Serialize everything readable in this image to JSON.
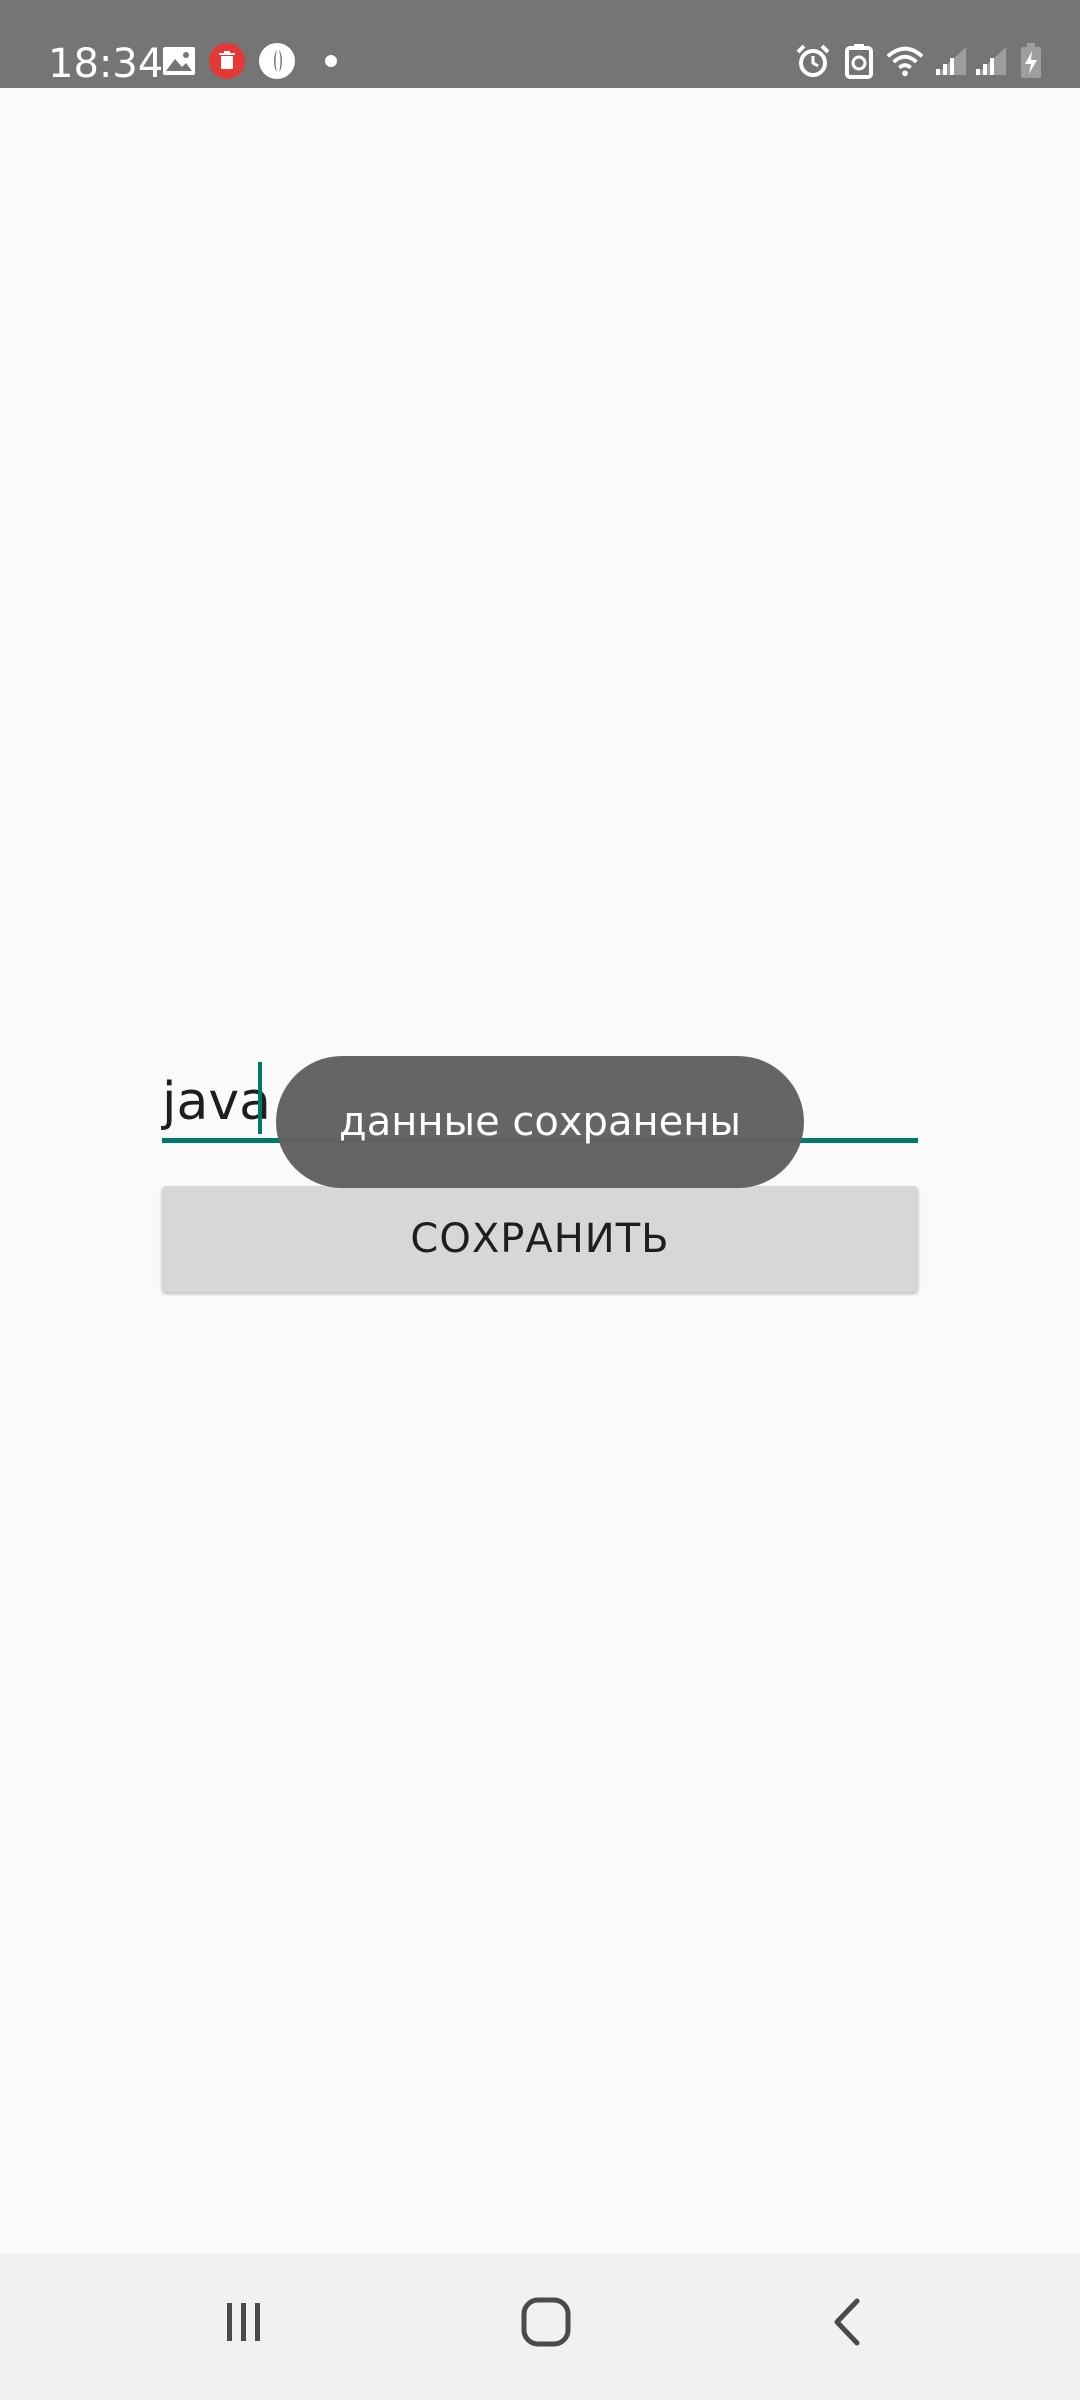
{
  "status_bar": {
    "time": "18:34",
    "left_icons": [
      "image-icon",
      "trash-badge-icon",
      "shield-icon",
      "dot-icon"
    ],
    "right_icons": [
      "alarm-icon",
      "battery-saver-icon",
      "wifi-icon",
      "signal-icon",
      "signal-icon",
      "battery-charging-icon"
    ]
  },
  "main": {
    "input_value": "java",
    "save_button_label": "СОХРАНИТЬ"
  },
  "toast": {
    "message": "данные сохранены"
  },
  "nav_bar": {
    "buttons": [
      "recent-apps",
      "home",
      "back"
    ]
  },
  "colors": {
    "accent": "#00796b",
    "status_bar": "#757575",
    "background": "#fafafa",
    "button": "#d6d7d7",
    "toast": "#606060",
    "trash_badge": "#e53935"
  }
}
